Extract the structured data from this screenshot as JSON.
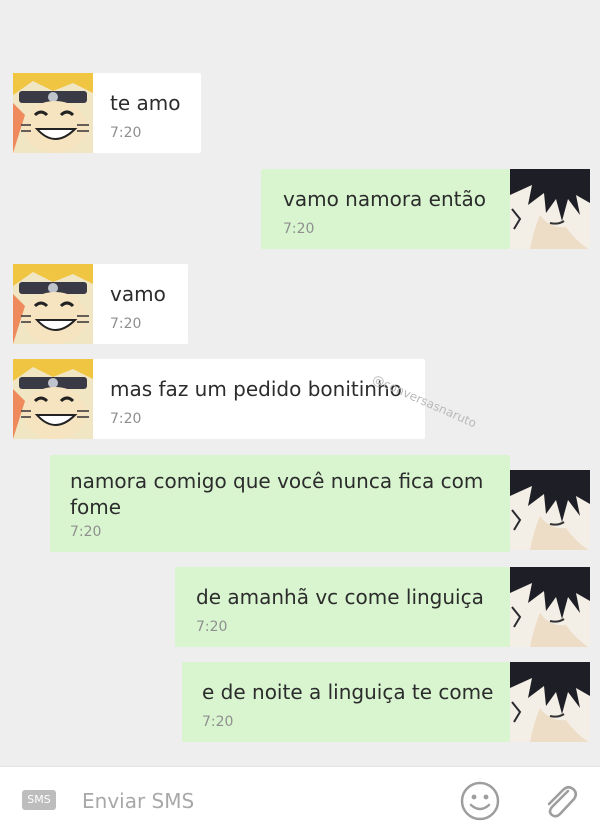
{
  "messages": [
    {
      "side": "in",
      "text": "te amo",
      "time": "7:20",
      "avatar": "naruto-avatar"
    },
    {
      "side": "out",
      "text": "vamo namora então",
      "time": "7:20",
      "avatar": "sasuke-avatar"
    },
    {
      "side": "in",
      "text": "vamo",
      "time": "7:20",
      "avatar": "naruto-avatar"
    },
    {
      "side": "in",
      "text": "mas faz um pedido bonitinho",
      "time": "7:20",
      "avatar": "naruto-avatar"
    },
    {
      "side": "out",
      "text_line1": "namora comigo que você nunca fica com",
      "text_line2": "fome",
      "time": "7:20",
      "avatar": "sasuke-avatar"
    },
    {
      "side": "out",
      "text": "de amanhã vc come linguiça",
      "time": "7:20",
      "avatar": "sasuke-avatar"
    },
    {
      "side": "out",
      "text": "e de noite a linguiça te come",
      "time": "7:20",
      "avatar": "sasuke-avatar"
    }
  ],
  "watermark": "@conversasnaruto",
  "input_bar": {
    "sms_badge": "SMS",
    "placeholder": "Enviar SMS",
    "emoji_icon": "smiley-icon",
    "attach_icon": "paperclip-icon"
  },
  "colors": {
    "background": "#eeeeee",
    "incoming_bubble": "#ffffff",
    "outgoing_bubble": "#d9f5d0",
    "time_text": "#8f8f8f"
  }
}
